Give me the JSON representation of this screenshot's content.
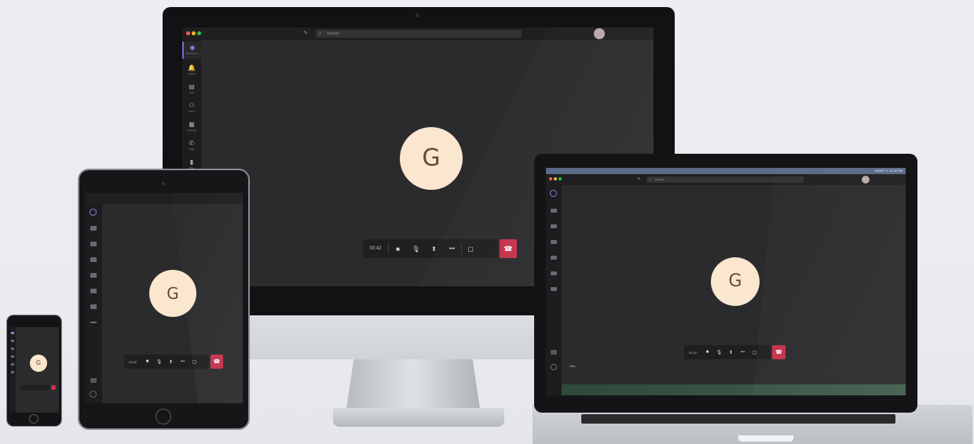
{
  "app": {
    "search_placeholder": "Search",
    "participant_initial": "G",
    "call_timer": "00:42",
    "laptop_status_right": "DEMO  ᯤ  12:00 PM",
    "laptop_caption": "Gen",
    "rail": [
      {
        "icon": "🔔",
        "label": "Activity"
      },
      {
        "icon": "▤",
        "label": "Chat"
      },
      {
        "icon": "⚇",
        "label": "Teams"
      },
      {
        "icon": "▦",
        "label": "Calendar"
      },
      {
        "icon": "✆",
        "label": "Calls"
      },
      {
        "icon": "▮",
        "label": "Files"
      }
    ],
    "rail_active_label": "Bellevue S..."
  },
  "controls": {
    "video_icon": "■",
    "mic_icon": "🎙",
    "share_icon": "⬆",
    "more_icon": "•••",
    "chat_icon": "▢",
    "hangup_icon": "☎"
  },
  "colors": {
    "hangup": "#c4314b",
    "avatar_bg": "#fbe6cf",
    "accent": "#6b6fd8"
  }
}
